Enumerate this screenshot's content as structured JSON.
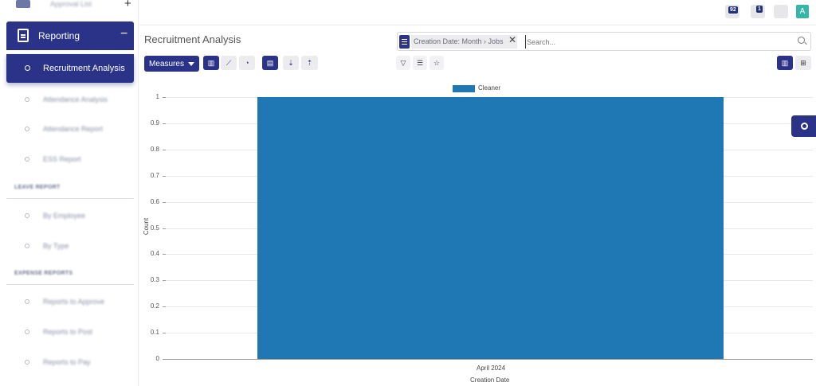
{
  "sidebar": {
    "top_label": "Approval List",
    "reporting_label": "Reporting",
    "active_item": "Recruitment Analysis",
    "items": [
      {
        "label": "Attendance Analysis"
      },
      {
        "label": "Attendance Report"
      },
      {
        "label": "ESS Report"
      },
      {
        "label": "By Employee"
      },
      {
        "label": "By Type"
      },
      {
        "label": "Reports to Approve"
      },
      {
        "label": "Reports to Post"
      },
      {
        "label": "Reports to Pay"
      }
    ],
    "sections": [
      "LEAVE REPORT",
      "EXPENSE REPORTS"
    ]
  },
  "topbar": {
    "messages_count": "92",
    "activity_count": "1",
    "avatar_letter": "A"
  },
  "page": {
    "title": "Recruitment Analysis"
  },
  "search": {
    "facet": "Creation Date: Month › Jobs",
    "placeholder": "Search..."
  },
  "toolbar": {
    "measures_label": "Measures"
  },
  "colors": {
    "primary": "#2a3388",
    "bar": "#1f77b4",
    "avatar": "#35b6a6"
  },
  "chart_data": {
    "type": "bar",
    "categories": [
      "April 2024"
    ],
    "series": [
      {
        "name": "Cleaner",
        "values": [
          1
        ]
      }
    ],
    "xlabel": "Creation Date",
    "ylabel": "Count",
    "ylim": [
      0,
      1
    ],
    "yticks": [
      "0",
      "0.1",
      "0.2",
      "0.3",
      "0.4",
      "0.5",
      "0.6",
      "0.7",
      "0.8",
      "0.9",
      "1"
    ],
    "legend": "top-center",
    "grid": true
  }
}
